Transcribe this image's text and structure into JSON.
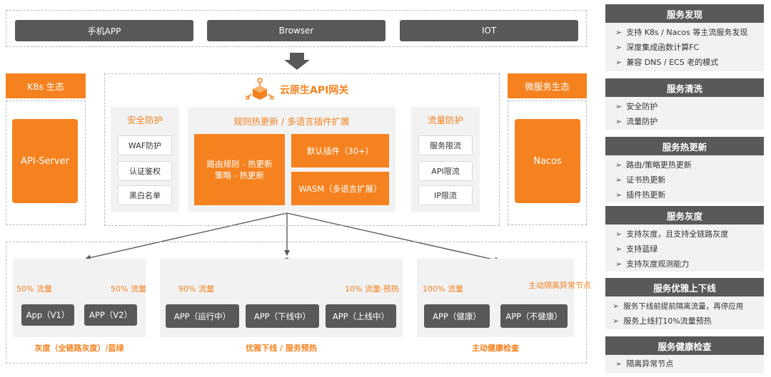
{
  "clients": [
    "手机APP",
    "Browser",
    "IOT"
  ],
  "gateway": {
    "title": "云原生API网关",
    "security": {
      "title": "安全防护",
      "items": [
        "WAF防护",
        "认证鉴权",
        "黑白名单"
      ]
    },
    "rules": {
      "title": "规则热更新 / 多语言插件扩展",
      "route_box": [
        "路由规则 - 热更新",
        "策略 - 热更新"
      ],
      "plugins_box": "默认插件（30+）",
      "wasm_box": "WASM（多语言扩展）"
    },
    "traffic": {
      "title": "流量防护",
      "items": [
        "服务限流",
        "API限流",
        "IP限流"
      ]
    }
  },
  "left_eco": {
    "title": "K8s 生态",
    "box": "API-Server"
  },
  "right_eco": {
    "title": "微服务生态",
    "box": "Nacos"
  },
  "scenarios": [
    {
      "labels": [
        "50% 流量",
        "50% 流量"
      ],
      "apps": [
        "App（V1）",
        "APP（V2）"
      ],
      "caption": "灰度（全链路灰度）/蓝绿"
    },
    {
      "labels": [
        "90% 流量",
        "10% 流量-预热"
      ],
      "apps": [
        "APP（运行中）",
        "APP（下线中）",
        "APP（上线中）"
      ],
      "caption": "优雅下线 / 服务预热"
    },
    {
      "labels": [
        "100% 流量",
        "主动隔离异常节点"
      ],
      "apps": [
        "APP（健康）",
        "APP（不健康）"
      ],
      "caption": "主动健康检查"
    }
  ],
  "features": [
    {
      "title": "服务发现",
      "items": [
        "支持 K8s / Nacos 等主流服务发现",
        "深度集成函数计算FC",
        "兼容 DNS / ECS 老的模式"
      ]
    },
    {
      "title": "服务清洗",
      "items": [
        "安全防护",
        "流量防护"
      ]
    },
    {
      "title": "服务热更新",
      "items": [
        "路由/策略更热更新",
        "证书热更新",
        "插件热更新"
      ]
    },
    {
      "title": "服务灰度",
      "items": [
        "支持灰度，且支持全链路灰度",
        "支持蓝绿",
        "支持灰度观测能力"
      ]
    },
    {
      "title": "服务优雅上下线",
      "items": [
        "服务下线前提前隔离流量，再停应用",
        "服务上线打10%流量预热"
      ]
    },
    {
      "title": "服务健康检查",
      "items": [
        "隔离异常节点"
      ]
    }
  ],
  "colors": {
    "accent": "#f5821f",
    "dark": "#595959",
    "panel": "#f2f2f2"
  },
  "icons": {
    "gateway": "gateway-cubes-icon",
    "arrow": "down-arrow-icon",
    "bullet": "triangle-bullet-icon"
  }
}
